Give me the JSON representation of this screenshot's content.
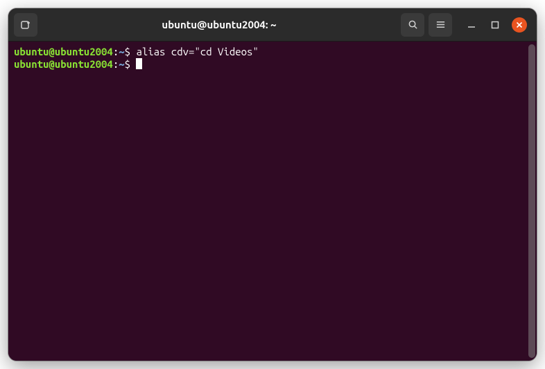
{
  "window": {
    "title": "ubuntu@ubuntu2004: ~"
  },
  "terminal": {
    "lines": [
      {
        "user_host": "ubuntu@ubuntu2004",
        "colon": ":",
        "path": "~",
        "dollar": "$ ",
        "command": "alias cdv=\"cd Videos\""
      },
      {
        "user_host": "ubuntu@ubuntu2004",
        "colon": ":",
        "path": "~",
        "dollar": "$ ",
        "command": ""
      }
    ]
  }
}
